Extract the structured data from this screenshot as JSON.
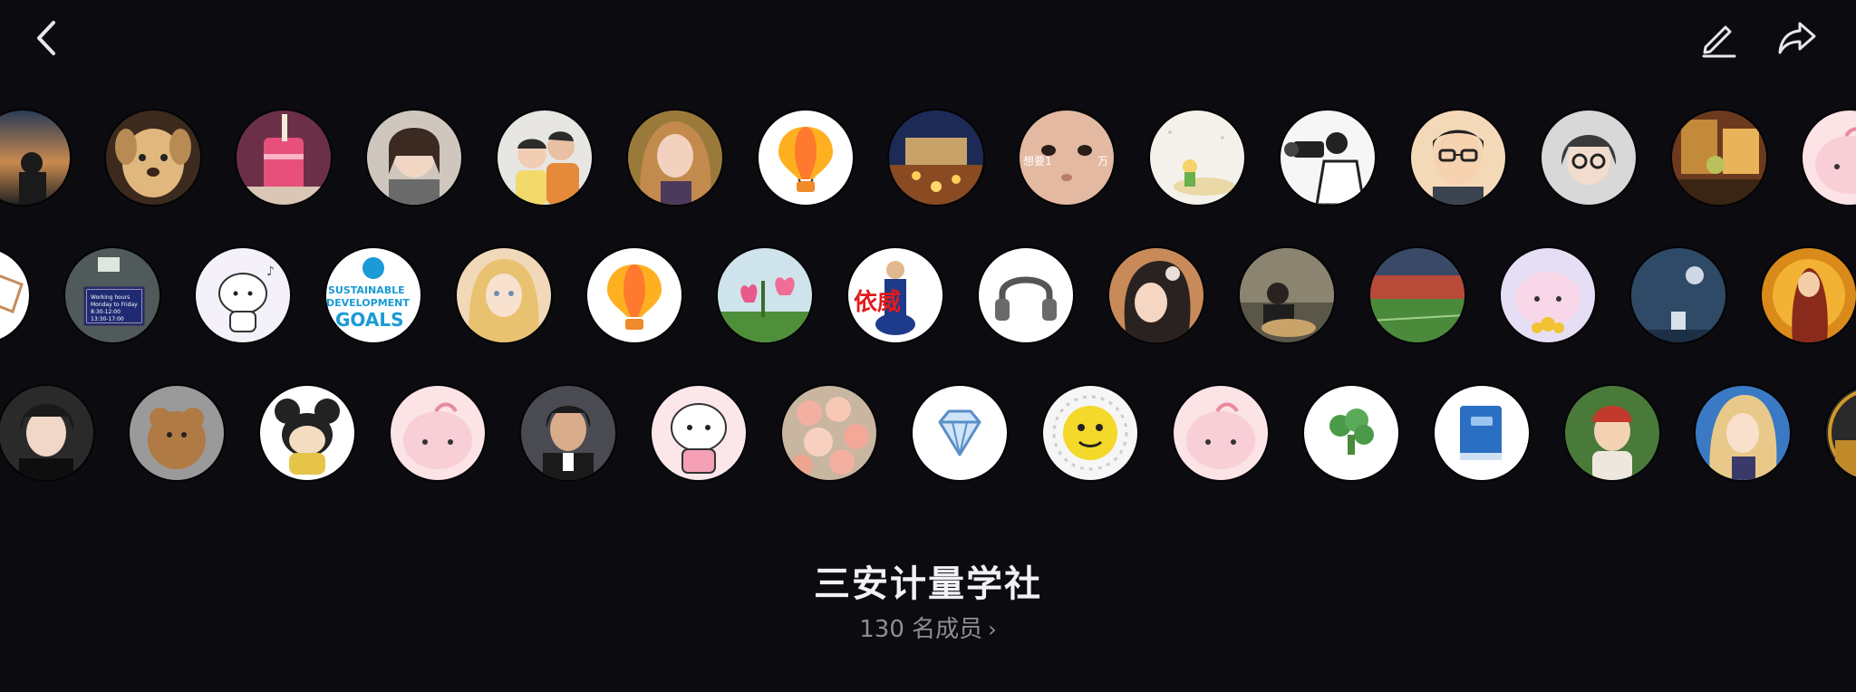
{
  "header": {
    "back_icon": "chevron-left-icon",
    "edit_icon": "pencil-icon",
    "share_icon": "share-arrow-icon"
  },
  "group": {
    "name": "三安计量学社",
    "member_count": "130 名成员",
    "chevron": "›"
  },
  "avatar_texts": {
    "sdg_line1": "SUSTAINABLE",
    "sdg_line2": "DEVELOPMENT",
    "sdg_line3": "GOALS",
    "office_sign1": "Working hours",
    "office_sign2": "Monday to Friday",
    "office_sign3": "8:30-12:00",
    "office_sign4": "13:30-17:00",
    "red_chars": "依威",
    "face_text": "想要1",
    "face_text2": "万"
  },
  "colors": {
    "background": "#0b0b10",
    "title": "#f2f2f4",
    "subtitle": "#8e8e96"
  }
}
